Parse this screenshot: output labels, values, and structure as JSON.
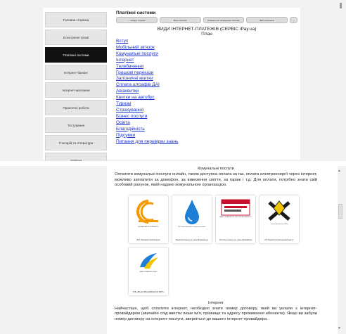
{
  "sidebar": {
    "items": [
      {
        "label": "Головна сторінка"
      },
      {
        "label": "Електронні гроші"
      },
      {
        "label": "Платіжні системи"
      },
      {
        "label": "Інтернет-банкінг"
      },
      {
        "label": "Інтернет-магазини"
      },
      {
        "label": "Практичні роботи"
      },
      {
        "label": "Тестування"
      },
      {
        "label": "Глосарій та література"
      },
      {
        "label": "Довідка"
      }
    ]
  },
  "main": {
    "section_title": "Платіжні системи",
    "tabs": [
      {
        "label": "←  назад в сторінки"
      },
      {
        "label": "Види платежів"
      },
      {
        "label": "Правила для проведення платежів"
      },
      {
        "label": "ФЕЗ-чорномель"
      },
      {
        "label": "→"
      }
    ],
    "heading": "ВИДИ ІНТЕРНЕТ-ПЛАТЕЖІВ (СЕРВІС iPay.ua)",
    "subheading": "План",
    "plan_links": [
      "Вступ",
      "Мобільний зв'язок",
      "Комунальні послуги",
      "Інтернет",
      "Телебачення",
      "Грошові перекази",
      "Залізничні квитки",
      "Сплата штрафів ДАІ",
      "Авіаквитки",
      "Квитки на автобус",
      "Туризм",
      "Страхування",
      "Бізнес послуги",
      "Освіта",
      "Благодійність",
      "Підсумки",
      "Питання для перевірки знань"
    ]
  },
  "article": {
    "title_utilities": "Комунальні послуги",
    "text_utilities": "Оплатити комунальні послуги онлайн, також доступна оплата за газ, оплата електроенергії через інтернет, можливо заплатити за домофон, за вивезення сміття, за гараж і т.д. Для оплати, потрібно знати свій особовий рахунок, який надано комунальною організацією.",
    "providers": [
      {
        "caption": "ПАТ Прикарпаттяобленерго",
        "logo_text": "ПРИКАРПАТТЯ ОБЛЕНЕРГО",
        "icon": "energy-logo-icon"
      },
      {
        "caption": "Водопостачання (м. Івано-Франківськ)",
        "logo_text": "КП \"Івано-Франківськ водоекотехпром\"",
        "icon": "water-drop-icon"
      },
      {
        "caption": "Теплопостачання (м. Івано-Франківськ)",
        "logo_text": "ІВАНО-ФРАНКІВСЬК ТЕПЛОКОМУНЕНЕРГО",
        "icon": "heat-logo-icon"
      },
      {
        "caption": "КП \"Єдиний розрахунковий центр\"",
        "logo_text": "Івано-Франківська ЄРЦ",
        "icon": "coat-of-arms-icon"
      },
      {
        "caption": "ТОВ «ІВАНО-ФРАНКІВСЬКГАЗ ЗБУТ»",
        "logo_text": "ІВАНО-ФРАНКІВСЬКГАЗ",
        "icon": "gas-logo-icon"
      }
    ],
    "title_internet": "Інтернет",
    "text_internet": "Найчастіше, щоб сплатити інтернет, необхідно знати номер договору, який ви уклали з інтернет-провайдером (звичайні слід ввести лише ім'я, прізвище та адресу проживання абонента). Якщо ви забули номер договору на інтернет-послуги, зверніться до вашого інтернет-провайдера."
  },
  "scroll": {
    "up": "▲",
    "down": "▼"
  },
  "colors": {
    "link": "#1a33cc",
    "active_nav": "#111111",
    "accent_orange": "#f29a00",
    "water_blue": "#1e7fd6"
  }
}
